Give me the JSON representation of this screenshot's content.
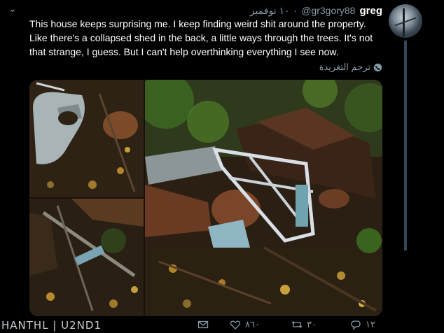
{
  "tweet": {
    "display_name": "greg",
    "handle": "@gr3gory88",
    "dot": "·",
    "timestamp": "١٠ نوفمبر",
    "text": "This house keeps surprising me. I keep finding weird shit around the property. Like there's a collapsed shed in the back, a little ways through the trees. It's not that strange, I guess. But I can't help overthinking everything I see now.",
    "translate_label": "ترجم التغريدة"
  },
  "actions": {
    "reply_count": "١٢",
    "retweet_count": "٣٠",
    "like_count": "٨٦٠"
  },
  "watermark": "HANTHL | U2ND1",
  "icons": [
    "avatar-photo",
    "chevron-down-icon",
    "globe-icon",
    "reply-icon",
    "retweet-icon",
    "heart-icon",
    "envelope-icon"
  ],
  "colors": {
    "background": "#000000",
    "text": "#ffffff",
    "secondary": "#8899a6",
    "thread_line": "#33475a"
  }
}
